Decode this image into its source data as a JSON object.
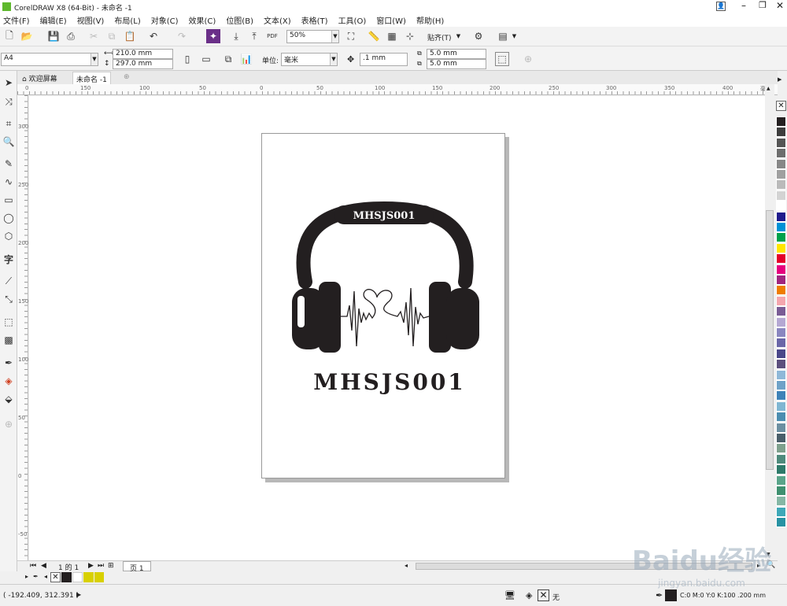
{
  "titlebar": {
    "title": "CorelDRAW X8 (64-Bit) - 未命名 -1"
  },
  "menu": [
    "文件(F)",
    "编辑(E)",
    "视图(V)",
    "布局(L)",
    "对象(C)",
    "效果(C)",
    "位图(B)",
    "文本(X)",
    "表格(T)",
    "工具(O)",
    "窗口(W)",
    "帮助(H)"
  ],
  "toolbar1": {
    "zoom": "50%",
    "snap_label": "贴齐(T)"
  },
  "toolbar2": {
    "page_size": "A4",
    "width": "210.0 mm",
    "height": "297.0 mm",
    "units_label": "单位:",
    "units": "毫米",
    "nudge": ".1 mm",
    "dup_x": "5.0 mm",
    "dup_y": "5.0 mm"
  },
  "tabs": {
    "welcome": "欢迎屏幕",
    "document": "未命名 -1"
  },
  "ruler": {
    "h_ticks": [
      "0",
      "150",
      "100",
      "50",
      "0",
      "50",
      "100",
      "150",
      "200",
      "250",
      "300",
      "350",
      "400"
    ],
    "unit": "毫米",
    "v_ticks": [
      "300",
      "250",
      "200",
      "150",
      "100",
      "50",
      "0",
      "-50"
    ]
  },
  "artwork": {
    "headband_text": "MHSJS001",
    "main_text": "MHSJS001"
  },
  "pagenav": {
    "page_count": "1 的 1",
    "page_tab": "页 1"
  },
  "status": {
    "coords": "( -192.409, 312.391 )",
    "fill_label": "无",
    "outline": "C:0 M:0 Y:0 K:100  .200 mm"
  },
  "watermark": {
    "logo": "Baidu经验",
    "url": "jingyan.baidu.com"
  },
  "colors": {
    "palette": [
      "#231f20",
      "#3d3d3d",
      "#555555",
      "#6e6e6e",
      "#878787",
      "#a0a0a0",
      "#bababa",
      "#d3d3d3",
      "#ffffff",
      "#1f1a8c",
      "#0091d5",
      "#00a14b",
      "#ffe600",
      "#e4002b",
      "#e6007e",
      "#a0257f",
      "#ef7d00",
      "#f4a6ae",
      "#7a5c95",
      "#b5a8d3",
      "#8a86c0",
      "#6a66a8",
      "#4a478a",
      "#5c4f7e",
      "#8fb8d8",
      "#6fa2c8",
      "#3e82b8",
      "#7fb6d2",
      "#4c8db0",
      "#6d8fa1",
      "#4a5e6a",
      "#7fa08d",
      "#4e8a7c",
      "#2e7a6a",
      "#5aa48a",
      "#3f9070",
      "#85b7a5",
      "#3ea8b8",
      "#2892a3"
    ]
  }
}
